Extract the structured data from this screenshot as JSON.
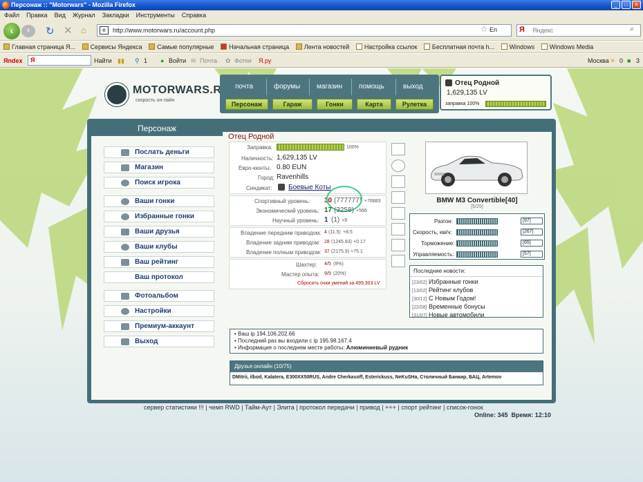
{
  "window": {
    "title": "Персонаж :: \"Motorwars\" - Mozilla Firefox"
  },
  "menubar": [
    "Файл",
    "Правка",
    "Вид",
    "Журнал",
    "Закладки",
    "Инструменты",
    "Справка"
  ],
  "navbar": {
    "url": "http://www.motorwars.ru/account.php",
    "search_placeholder": "Яндекс",
    "lang": "En"
  },
  "bookmarks": [
    "Главная страница Я...",
    "Сервисы Яндекса",
    "Самые популярные",
    "Начальная страница",
    "Лента новостей",
    "Настройка ссылок",
    "Бесплатная почта h...",
    "Windows",
    "Windows Media"
  ],
  "yandex_bar": {
    "brand": "Яndex",
    "find": "Найти",
    "count": "1",
    "login": "Войти",
    "mail": "Почта",
    "photos": "Фотки",
    "yaru": "Я.ру",
    "city": "Москва",
    "weather": "0",
    "other": "3"
  },
  "site": {
    "logo": "MOTORWARS.RU",
    "logo_sub": "скорость он-лайн",
    "top_links": [
      "почта",
      "форумы",
      "магазин",
      "помощь",
      "выход"
    ],
    "green_buttons": [
      "Персонаж",
      "Гараж",
      "Гонки",
      "Карта",
      "Рулетка"
    ],
    "user": {
      "name": "Отец Родной",
      "money": "1,629,135 LV",
      "fuel_label": "заправка 100%"
    }
  },
  "panel": {
    "tab": "Персонаж",
    "heading": "Отец Родной"
  },
  "left_menu": [
    "Послать деньги",
    "Магазин",
    "Поиск игрока",
    "Ваши гонки",
    "Избранные гонки",
    "Ваши друзья",
    "Ваши клубы",
    "Ваш рейтинг",
    "Ваш протокол",
    "Фотоальбом",
    "Настройки",
    "Премиум-аккаунт",
    "Выход"
  ],
  "profile": {
    "fuel_label": "Заправка:",
    "fuel_pct": "100%",
    "fuel_fraction": 1.0,
    "cash_label": "Наличность:",
    "cash": "1,629,135 LV",
    "euro_label": "Евро-кюнты:",
    "euro": "0.80 EUN",
    "city_label": "Город:",
    "city": "Ravenhills",
    "syndicate_label": "Синдикат:",
    "syndicate": "Боевые Коты",
    "sport_label": "Спортивный уровень:",
    "sport": "30",
    "sport_xp": "(777777)",
    "sport_next": "+76883",
    "econ_label": "Экономический уровень:",
    "econ": "17",
    "econ_xp": "(3258)",
    "econ_next": "+566",
    "sci_label": "Научный уровень:",
    "sci": "1",
    "sci_xp": "(1)",
    "sci_next": "+9",
    "fwd_label": "Владение передним приводом:",
    "fwd": "4",
    "fwd_xp": "(11.5)",
    "fwd_next": "+8.5",
    "rwd_label": "Владение задним приводом:",
    "rwd": "28",
    "rwd_xp": "(1245.83)",
    "rwd_next": "+0.17",
    "awd_label": "Владение полным приводом:",
    "awd": "37",
    "awd_xp": "(2175.9)",
    "awd_next": "+75.1",
    "miner_label": "Шахтер:",
    "miner": "4/5",
    "miner_pct": "(8%)",
    "master_label": "Мастер опыта:",
    "master": "9/9",
    "master_pct": "(20%)",
    "reset": "Сбросить очки умений за 499,303 LV"
  },
  "car": {
    "name": "BMW M3 Convertible[40]",
    "slots": "[5/25]",
    "stats": [
      {
        "label": "Разгон:",
        "value": "[97]"
      },
      {
        "label": "Скорость, км/ч:",
        "value": "[267]"
      },
      {
        "label": "Торможение:",
        "value": "[65]"
      },
      {
        "label": "Управляемость:",
        "value": "[57]"
      }
    ]
  },
  "news": {
    "title": "Последние новости:",
    "items": [
      {
        "date": "[23/02]",
        "text": "Избранные гонки"
      },
      {
        "date": "[13/02]",
        "text": "Рейтинг клубов"
      },
      {
        "date": "[30/12]",
        "text": "С Новым Годом!"
      },
      {
        "date": "[22/08]",
        "text": "Временные бонусы"
      },
      {
        "date": "[31/07]",
        "text": "Новые автомобили"
      }
    ]
  },
  "info": {
    "ip": "Ваш ip 194.106.202.66",
    "last": "Последний раз вы входили с ip 195.98.167.4",
    "work_prefix": "Информация о последнем месте работы:",
    "work": "Алюминиевый рудник"
  },
  "friends": {
    "title": "Друзья онлайн (10/75)",
    "list": "DMitrii, ilbod, Kalatera, E300XX50RUS, Andre Cherkasoff, Esterickuss, NeKuSHa, Столичный Банкир, БАЦ, Artemov"
  },
  "footer": {
    "links": "сервер статистики !!! | чемп RWD | Тайм-Аут | Элита | протокол передачи | привод | +++ | спорт рейтинг | список-гонок",
    "online": "Online: 345  Время: 12:10"
  },
  "colors": {
    "panel": "#456f78",
    "accent_green": "#9cbc3a",
    "heading": "#8a0f0f"
  }
}
